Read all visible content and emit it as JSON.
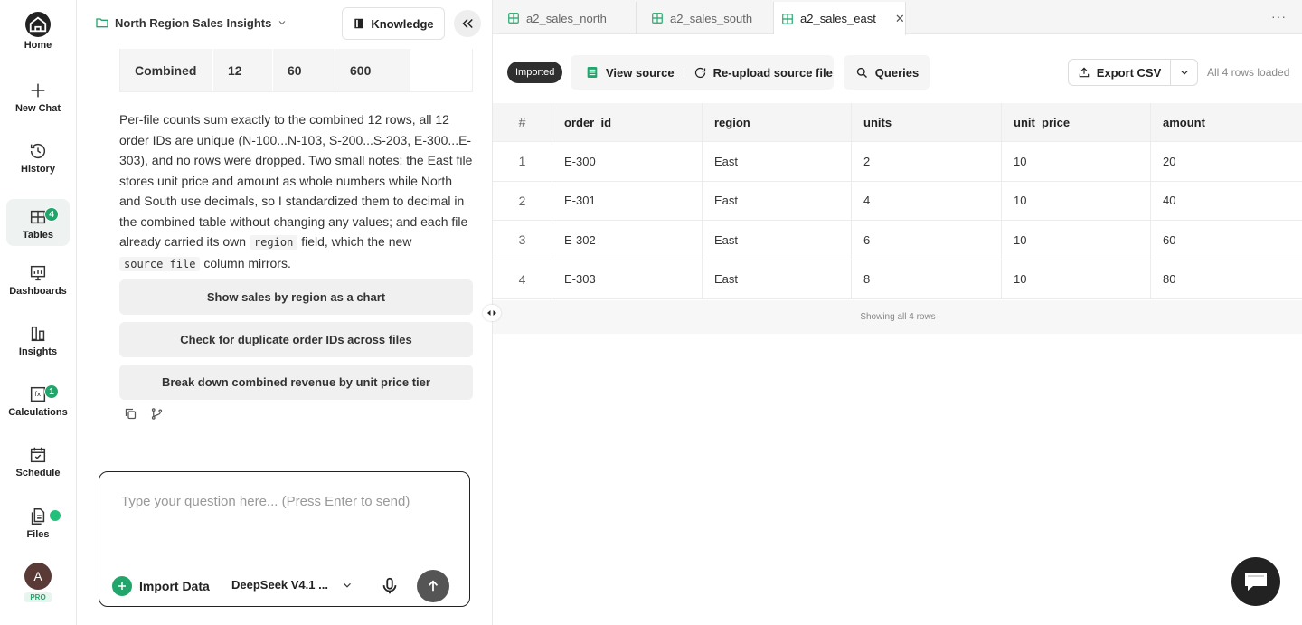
{
  "nav": {
    "items": [
      {
        "label": "Home",
        "icon": "home-icon"
      },
      {
        "label": "New Chat",
        "icon": "plus-icon"
      },
      {
        "label": "History",
        "icon": "history-icon"
      },
      {
        "label": "Tables",
        "icon": "tables-icon",
        "badge": "4",
        "active": true
      },
      {
        "label": "Dashboards",
        "icon": "dashboard-icon"
      },
      {
        "label": "Insights",
        "icon": "insights-icon"
      },
      {
        "label": "Calculations",
        "icon": "calculations-icon",
        "badge": "1"
      },
      {
        "label": "Schedule",
        "icon": "calendar-icon"
      },
      {
        "label": "Files",
        "icon": "files-icon"
      }
    ],
    "avatar_letter": "A",
    "plan_badge": "PRO"
  },
  "chat": {
    "project_title": "North Region Sales Insights",
    "knowledge_label": "Knowledge",
    "mini_table": [
      "Combined",
      "12",
      "60",
      "600"
    ],
    "message_parts": [
      "Per-file counts sum exactly to the combined 12 rows, all 12 order IDs are unique (N-100...N-103, S-200...S-203, E-300...E-303), and no rows were dropped. Two small notes: the East file stores unit price and amount as whole numbers while North and South use decimals, so I standardized them to decimal in the combined table without changing any values; and each file already carried its own ",
      "region",
      " field, which the new ",
      "source_file",
      " column mirrors."
    ],
    "suggestions": [
      "Show sales by region as a chart",
      "Check for duplicate order IDs across files",
      "Break down combined revenue by unit price tier"
    ],
    "composer": {
      "placeholder": "Type your question here... (Press Enter to send)",
      "import_label": "Import Data",
      "model_label": "DeepSeek V4.1 ..."
    }
  },
  "tabs": [
    {
      "label": "a2_sales_north",
      "active": false
    },
    {
      "label": "a2_sales_south",
      "active": false
    },
    {
      "label": "a2_sales_east",
      "active": true
    }
  ],
  "toolbar": {
    "status_badge": "Imported",
    "view_source": "View source",
    "reupload": "Re-upload source file",
    "queries": "Queries",
    "export": "Export CSV",
    "rows_loaded": "All 4 rows loaded"
  },
  "table": {
    "columns": [
      "#",
      "order_id",
      "region",
      "units",
      "unit_price",
      "amount"
    ],
    "rows": [
      [
        "1",
        "E-300",
        "East",
        "2",
        "10",
        "20"
      ],
      [
        "2",
        "E-301",
        "East",
        "4",
        "10",
        "40"
      ],
      [
        "3",
        "E-302",
        "East",
        "6",
        "10",
        "60"
      ],
      [
        "4",
        "E-303",
        "East",
        "8",
        "10",
        "80"
      ]
    ],
    "footer": "Showing all 4 rows"
  },
  "colors": {
    "accent": "#22a56b",
    "dark": "#222222"
  }
}
